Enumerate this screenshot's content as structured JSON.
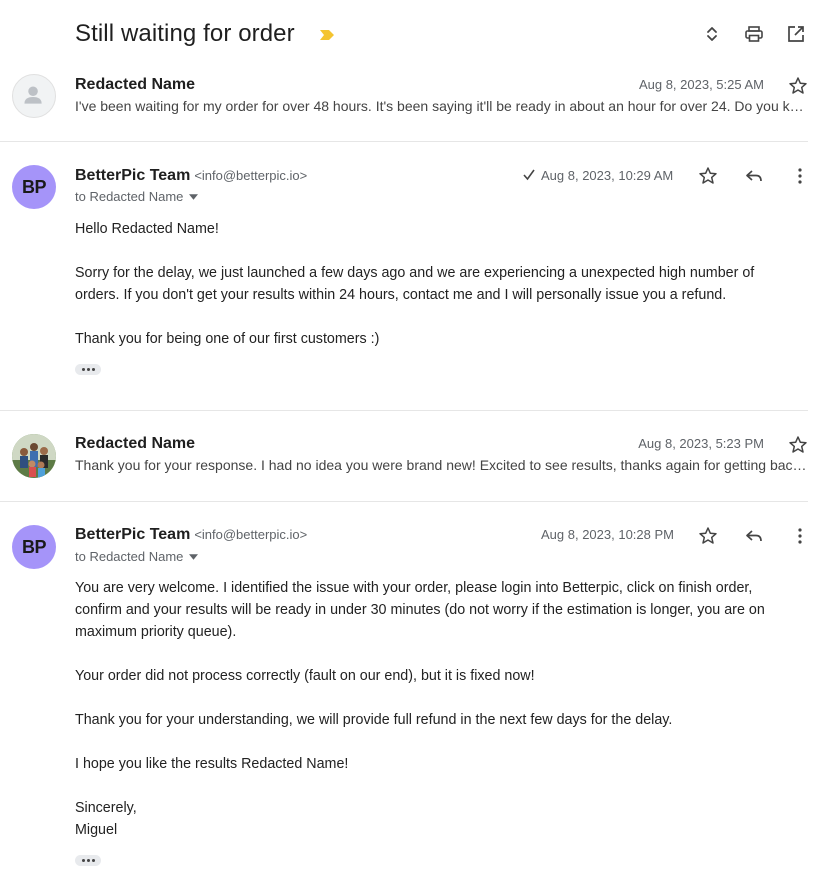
{
  "subject": "Still waiting for order",
  "messages": [
    {
      "sender": "Redacted Name",
      "date": "Aug 8, 2023, 5:25 AM",
      "snippet": "I've been waiting for my order for over 48 hours. It's been saying it'll be ready in about an hour for over 24. Do you know when it'll be ready?"
    },
    {
      "sender": "BetterPic Team",
      "email": "<info@betterpic.io>",
      "avatar_initials": "BP",
      "to": "to Redacted Name",
      "date": "Aug 8, 2023, 10:29 AM",
      "paragraphs": [
        "Hello Redacted Name!",
        "Sorry for the delay, we just launched a few days ago and we are experiencing a unexpected high number of orders. If you don't get your results within 24 hours, contact me and I will personally issue you a refund.",
        "Thank you for being one of our first customers :)"
      ]
    },
    {
      "sender": "Redacted Name",
      "date": "Aug 8, 2023, 5:23 PM",
      "snippet": "Thank you for your response. I had no idea you were brand new! Excited to see results, thanks again for getting back to me."
    },
    {
      "sender": "BetterPic Team",
      "email": "<info@betterpic.io>",
      "avatar_initials": "BP",
      "to": "to Redacted Name",
      "date": "Aug 8, 2023, 10:28 PM",
      "paragraphs": [
        "You are very welcome. I identified the issue with your order, please login into Betterpic, click on finish order, confirm and your results will be ready in under 30 minutes (do not worry if the estimation is longer, you are on maximum priority queue).",
        "Your order did not process correctly (fault on our end), but it is fixed now!",
        "Thank you for your understanding, we will provide full refund in the next few days for the delay.",
        "I hope you like the results Redacted Name!"
      ],
      "signoff": "Sincerely,",
      "signature": "Miguel"
    }
  ],
  "icons": {
    "label": "label-important-icon",
    "expand": "unfold-icon",
    "print": "print-icon",
    "open_new": "open-in-new-icon",
    "star": "star-icon",
    "reply": "reply-icon",
    "more": "more-vert-icon",
    "tick": "sent-check-icon"
  },
  "colors": {
    "avatar_bp": "#a594f9",
    "label": "#f4c430",
    "meta": "#5f6368"
  }
}
